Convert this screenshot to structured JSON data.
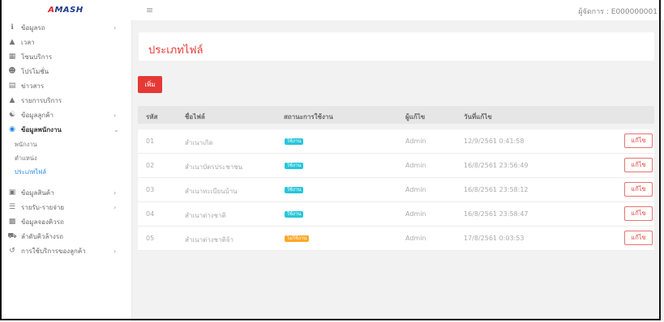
{
  "header": {
    "logo_text_a": "A",
    "logo_text_b": "MASH",
    "manager_label": "ผู้จัดการ : E000000001"
  },
  "sidebar": {
    "items": [
      {
        "label": "ข้อมูลรถ",
        "icon": "info-icon"
      },
      {
        "label": "เวลา",
        "icon": "bank-icon"
      },
      {
        "label": "โซนบริการ",
        "icon": "grid-icon"
      },
      {
        "label": "โปรโมชั่น",
        "icon": "user-tag-icon"
      },
      {
        "label": "ข่าวสาร",
        "icon": "newspaper-icon"
      },
      {
        "label": "รายการบริการ",
        "icon": "bank-icon"
      },
      {
        "label": "ข้อมูลลูกค้า",
        "icon": "users-icon"
      },
      {
        "label": "ข้อมูลพนักงาน",
        "icon": "user-circle-icon"
      },
      {
        "label": "ข้อมูลสินค้า",
        "icon": "box-icon"
      },
      {
        "label": "รายรับ-รายจ่าย",
        "icon": "list-icon"
      },
      {
        "label": "ข้อมูลจองคิวรถ",
        "icon": "calendar-icon"
      },
      {
        "label": "ลำดับคิวล้างรถ",
        "icon": "car-icon"
      },
      {
        "label": "การใช้บริการของลูกค้า",
        "icon": "history-icon"
      }
    ],
    "subitems": [
      "พนักงาน",
      "ตำแหน่ง",
      "ประเภทไฟล์"
    ]
  },
  "main": {
    "title": "ประเภทไฟล์",
    "add_label": "เพิ่ม",
    "columns": [
      "รหัส",
      "ชื่อไฟล์",
      "สถานะการใช้งาน",
      "ผู้แก้ไข",
      "วันที่แก้ไข"
    ],
    "edit_label": "แก้ไข",
    "rows": [
      {
        "id": "01",
        "name": "สำเนาเกิด",
        "status": "ใช้งาน",
        "active": true,
        "editor": "Admin",
        "date": "12/9/2561 0:41:58"
      },
      {
        "id": "02",
        "name": "สำเนาบัตรประชาชน",
        "status": "ใช้งาน",
        "active": true,
        "editor": "Admin",
        "date": "16/8/2561 23:56:49"
      },
      {
        "id": "03",
        "name": "สำเนาทะเบียนบ้าน",
        "status": "ใช้งาน",
        "active": true,
        "editor": "Admin",
        "date": "16/8/2561 23:58:12"
      },
      {
        "id": "04",
        "name": "สำเนาต่างชาติ",
        "status": "ใช้งาน",
        "active": true,
        "editor": "Admin",
        "date": "16/8/2561 23:58:47"
      },
      {
        "id": "05",
        "name": "สำเนาต่างชาติจ้า",
        "status": "ไม่ใช้งาน",
        "active": false,
        "editor": "Admin",
        "date": "17/8/2561 0:03:53"
      }
    ]
  },
  "colors": {
    "accent": "#e53935",
    "active_badge": "#26c6da",
    "inactive_badge": "#ffa726",
    "link": "#1e88e5"
  }
}
